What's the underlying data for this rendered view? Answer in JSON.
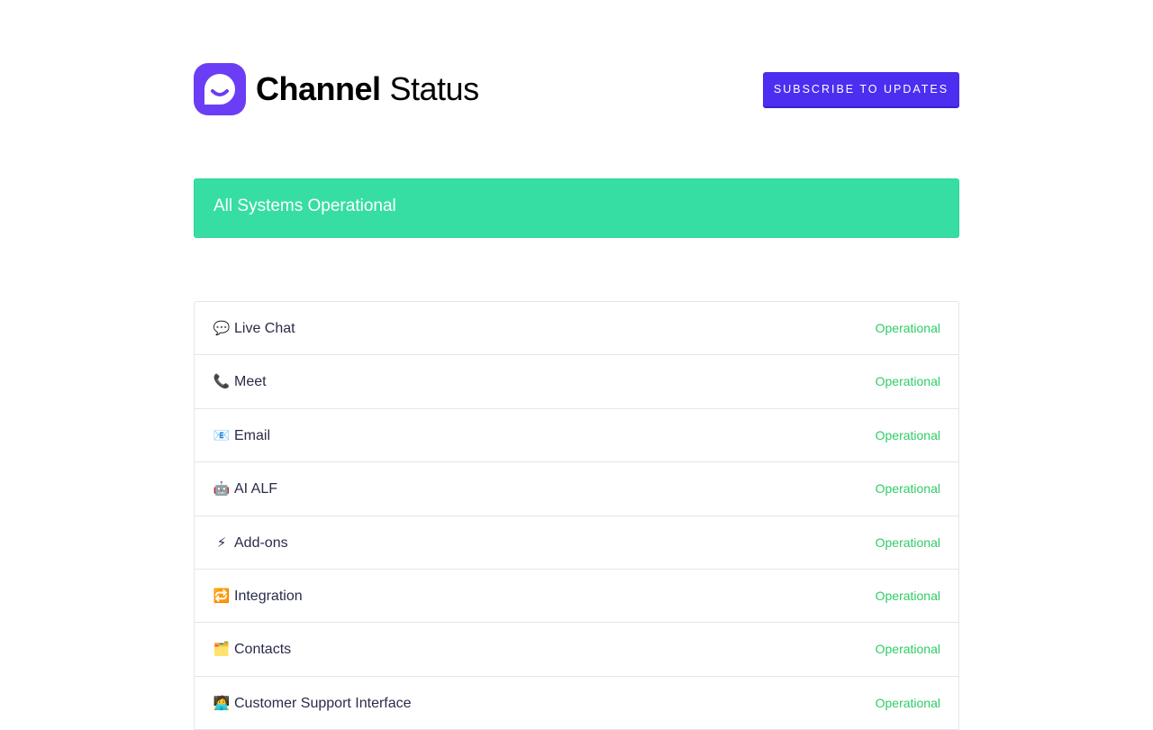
{
  "header": {
    "logo_bold": "Channel",
    "logo_light": "Status",
    "subscribe_label": "Subscribe to Updates"
  },
  "banner": {
    "text": "All Systems Operational",
    "color": "#36dea4"
  },
  "colors": {
    "brand": "#6b3df5",
    "button": "#4b2ef0",
    "operational": "#2fcc66"
  },
  "components": [
    {
      "icon": "💬",
      "icon_name": "speech-bubble-icon",
      "name": "Live Chat",
      "status": "Operational"
    },
    {
      "icon": "📞",
      "icon_name": "telephone-icon",
      "name": "Meet",
      "status": "Operational"
    },
    {
      "icon": "📧",
      "icon_name": "email-icon",
      "name": "Email",
      "status": "Operational"
    },
    {
      "icon": "🤖",
      "icon_name": "robot-icon",
      "name": "AI ALF",
      "status": "Operational"
    },
    {
      "icon": "⚡",
      "icon_name": "lightning-icon",
      "name": "Add-ons",
      "status": "Operational"
    },
    {
      "icon": "🔁",
      "icon_name": "repeat-icon",
      "name": "Integration",
      "status": "Operational"
    },
    {
      "icon": "🗂️",
      "icon_name": "card-index-dividers-icon",
      "name": "Contacts",
      "status": "Operational"
    },
    {
      "icon": "🧑‍💻",
      "icon_name": "technologist-icon",
      "name": "Customer Support Interface",
      "status": "Operational"
    }
  ]
}
